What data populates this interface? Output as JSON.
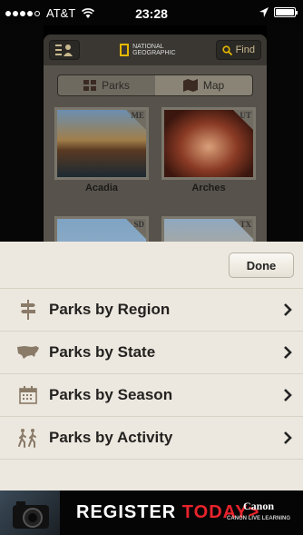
{
  "status_bar": {
    "carrier": "AT&T",
    "time": "23:28"
  },
  "background_app": {
    "logo_text_line1": "NATIONAL",
    "logo_text_line2": "GEOGRAPHIC",
    "find_label": "Find",
    "tabs": [
      {
        "label": "Parks",
        "icon": "grid-icon",
        "selected": true
      },
      {
        "label": "Map",
        "icon": "map-icon",
        "selected": false
      }
    ],
    "parks": [
      {
        "name": "Acadia",
        "state": "ME"
      },
      {
        "name": "Arches",
        "state": "UT"
      },
      {
        "name": "",
        "state": "SD"
      },
      {
        "name": "",
        "state": "TX"
      }
    ]
  },
  "sheet": {
    "done_label": "Done",
    "items": [
      {
        "label": "Parks by Region",
        "icon": "signpost-icon"
      },
      {
        "label": "Parks by State",
        "icon": "usa-map-icon"
      },
      {
        "label": "Parks by Season",
        "icon": "calendar-icon"
      },
      {
        "label": "Parks by Activity",
        "icon": "hikers-icon"
      }
    ]
  },
  "ad": {
    "text_white": "REGISTER ",
    "text_red": "TODAY>",
    "brand": "Canon",
    "brand_sub": "CANON LIVE LEARNING"
  },
  "colors": {
    "sheet_bg": "#ece8df",
    "ad_accent": "#e8232b",
    "logo_yellow": "#e6b800"
  }
}
